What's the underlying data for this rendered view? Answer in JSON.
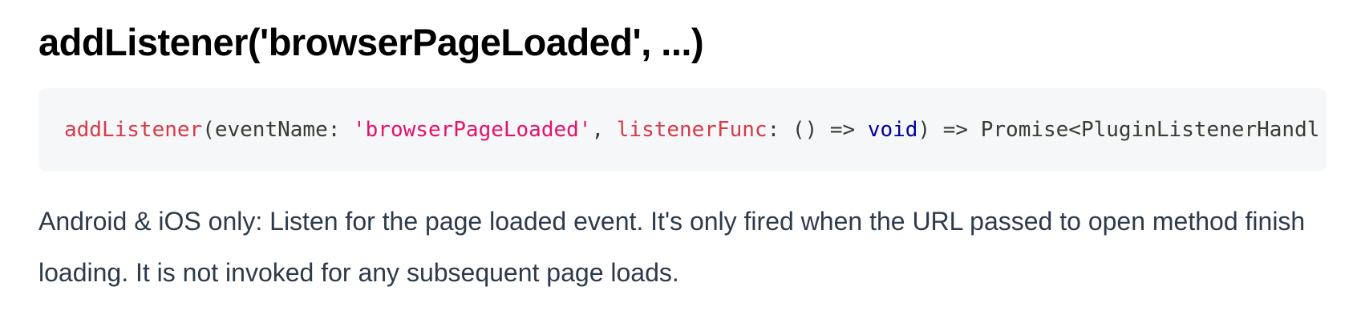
{
  "heading": "addListener('browserPageLoaded', ...)",
  "code": {
    "fn_name": "addListener",
    "open_paren": "(",
    "param1": "eventName: ",
    "event_string": "'browserPageLoaded'",
    "comma": ", ",
    "param2_name": "listenerFunc",
    "param2_type": ": () => ",
    "void_kw": "void",
    "return_type": ") => Promise<PluginListenerHandl"
  },
  "description": "Android & iOS only: Listen for the page loaded event. It's only fired when the URL passed to open method finish loading. It is not invoked for any subsequent page loads."
}
